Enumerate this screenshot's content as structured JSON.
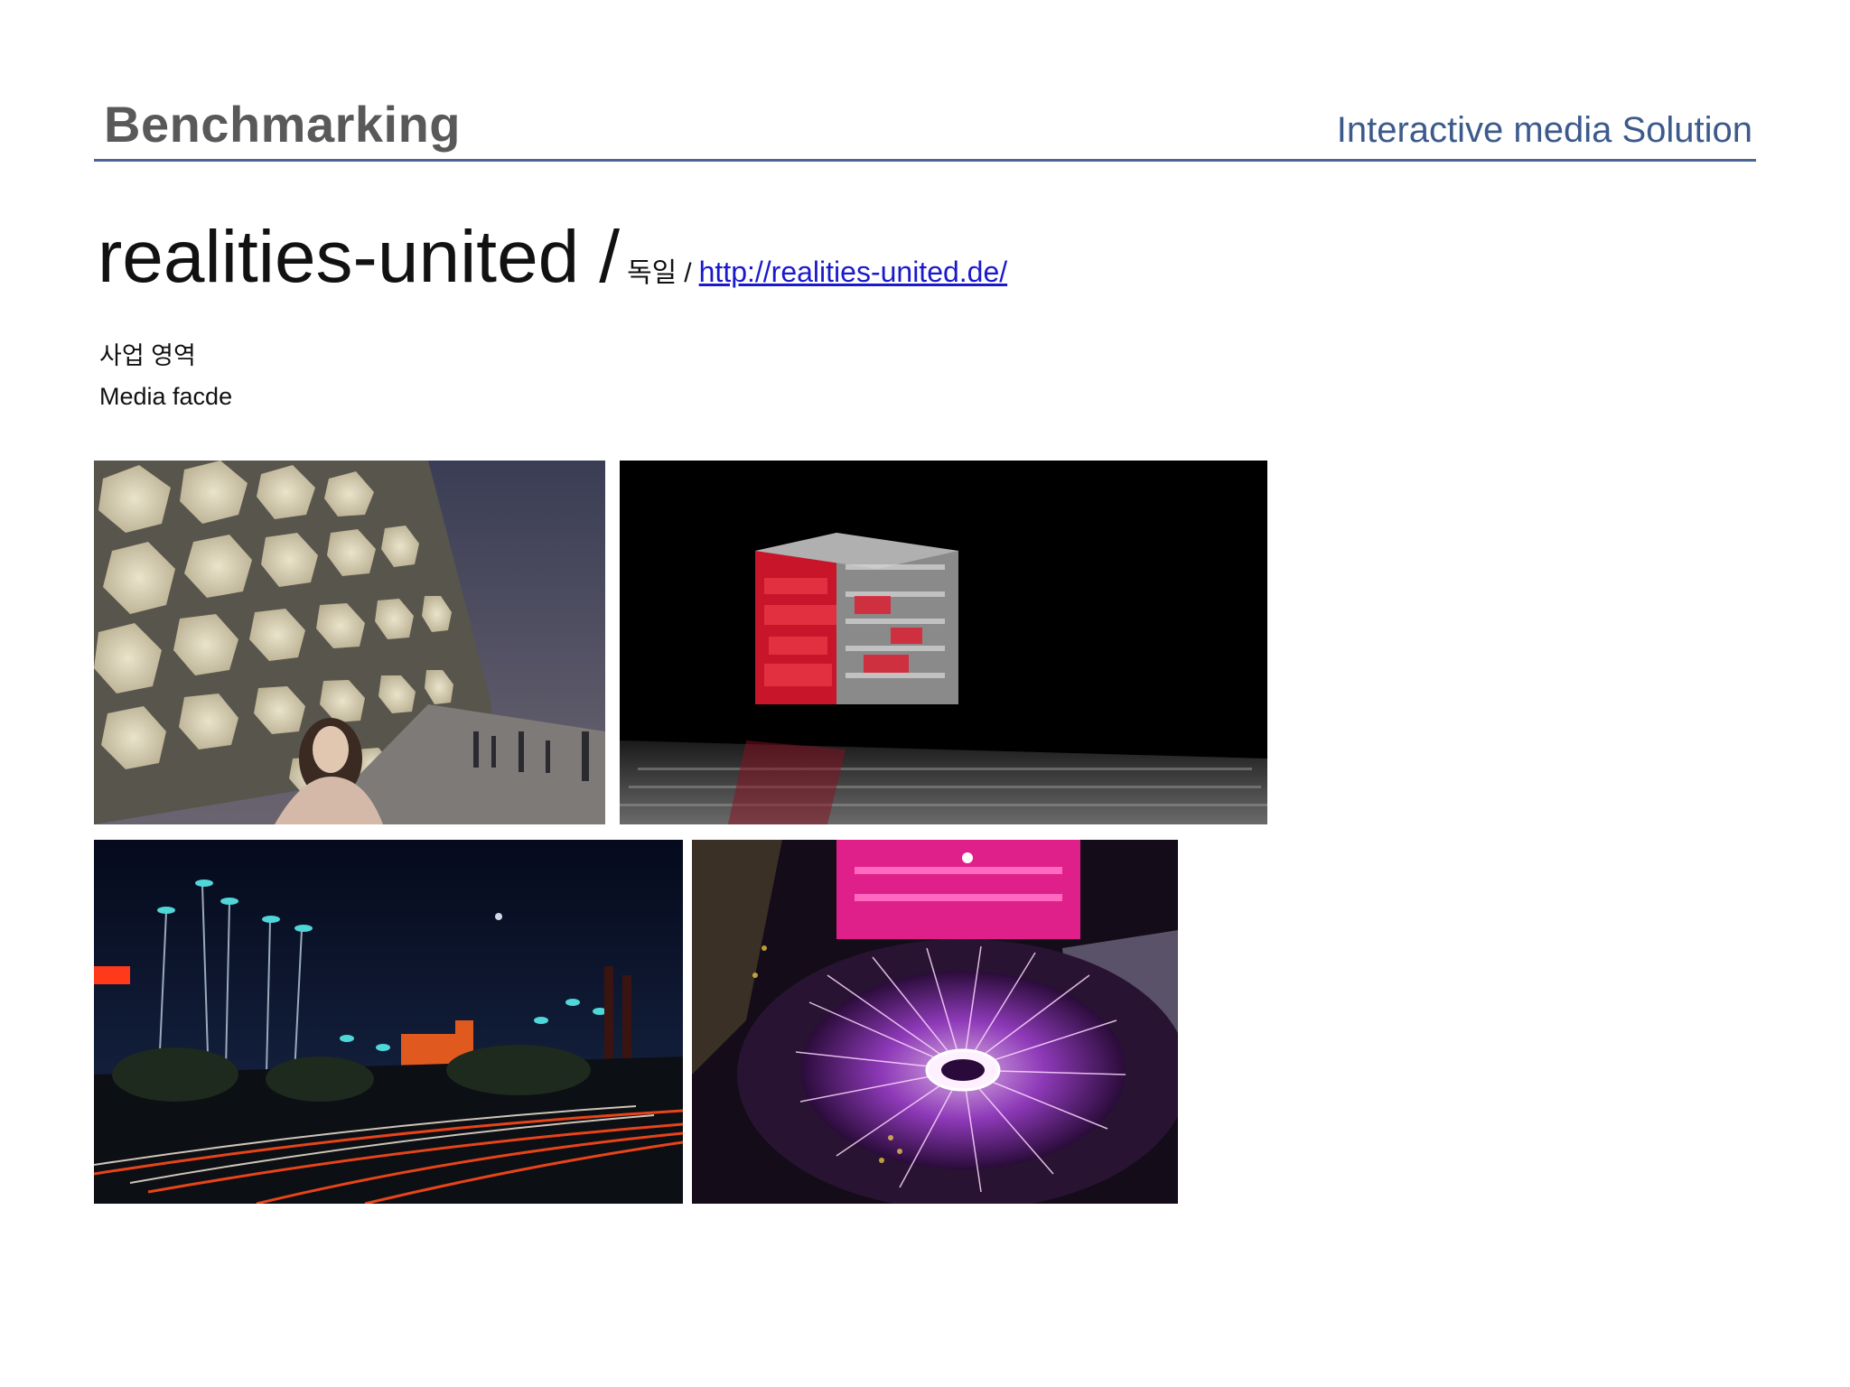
{
  "header": {
    "title": "Benchmarking",
    "subtitle": "Interactive media Solution"
  },
  "company": {
    "name": "realities-united",
    "slash": "/",
    "country": "독일",
    "separator": "/",
    "url": "http://realities-united.de/"
  },
  "section": {
    "label": "사업 영역",
    "value": "Media facde"
  },
  "colors": {
    "accent": "#4a6496",
    "link": "#1a1acc"
  }
}
